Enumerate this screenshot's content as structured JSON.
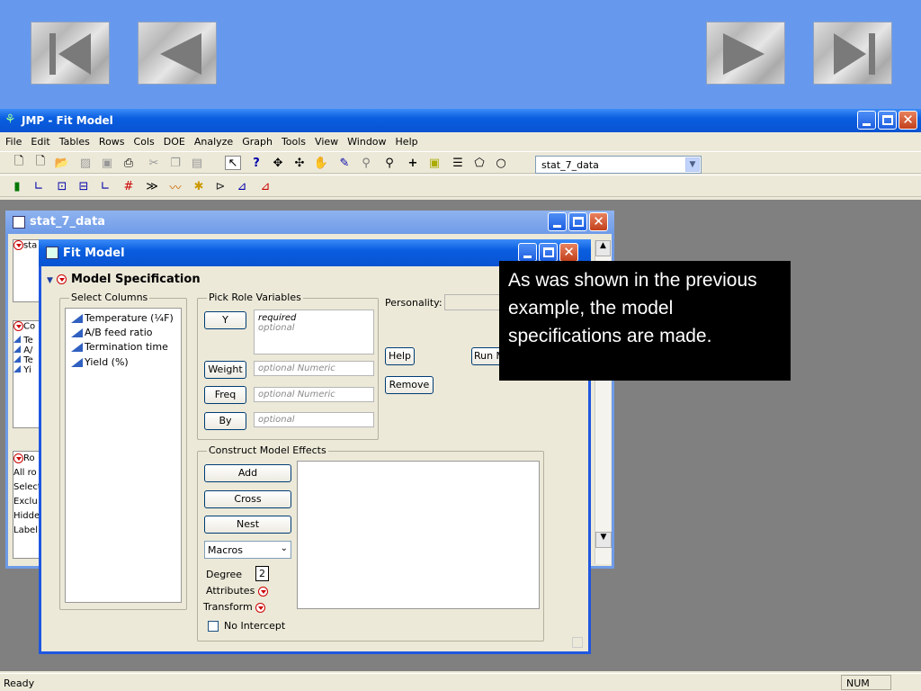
{
  "nav": {
    "buttons": [
      "first-slide",
      "previous-slide",
      "next-slide",
      "last-slide"
    ]
  },
  "app": {
    "title": "JMP - Fit Model",
    "status_left": "Ready",
    "status_num": "NUM"
  },
  "menu": [
    "File",
    "Edit",
    "Tables",
    "Rows",
    "Cols",
    "DOE",
    "Analyze",
    "Graph",
    "Tools",
    "View",
    "Window",
    "Help"
  ],
  "toolbar": {
    "table_select": "stat_7_data"
  },
  "data_window": {
    "title": "stat_7_data",
    "panel1": "sta",
    "panel2": [
      "Co",
      "Te",
      "A/",
      "Te",
      "Yi"
    ],
    "panel3": [
      "Ro",
      "All ro",
      "Select",
      "Exclu",
      "Hidde",
      "Label"
    ]
  },
  "fit_model": {
    "title": "Fit Model",
    "section": "Model Specification",
    "select_columns_label": "Select Columns",
    "columns": [
      "Temperature (¼F)",
      "A/B feed ratio",
      "Termination time",
      "Yield (%)"
    ],
    "pick_role_label": "Pick Role Variables",
    "y_button": "Y",
    "y_required": "required",
    "y_optional": "optional",
    "weight_button": "Weight",
    "weight_placeholder": "optional Numeric",
    "freq_button": "Freq",
    "freq_placeholder": "optional Numeric",
    "by_button": "By",
    "by_placeholder": "optional",
    "personality_label": "Personality:",
    "help_button": "Help",
    "run_button": "Run M",
    "remove_button": "Remove",
    "construct_label": "Construct Model Effects",
    "add_button": "Add",
    "cross_button": "Cross",
    "nest_button": "Nest",
    "macros": "Macros",
    "degree_label": "Degree",
    "degree_value": "2",
    "attributes_label": "Attributes",
    "transform_label": "Transform",
    "no_intercept": "No Intercept"
  },
  "callout": "As was shown in the previous example, the model specifications are made."
}
